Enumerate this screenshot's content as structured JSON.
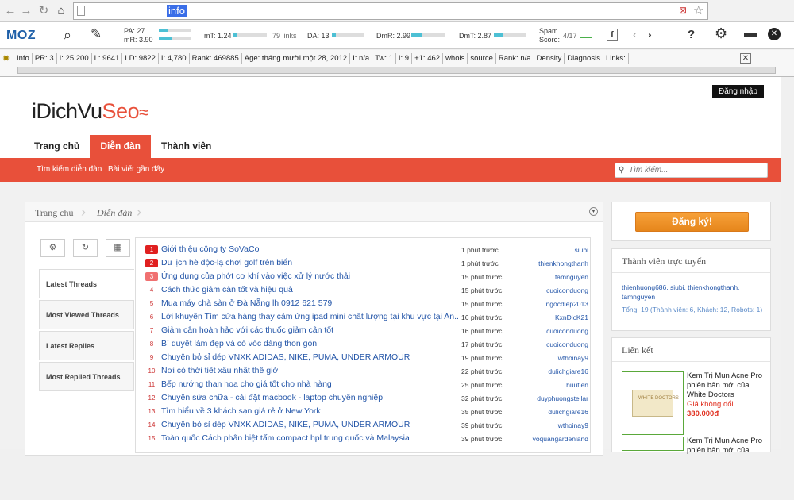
{
  "browser": {
    "url": "info",
    "back_icon": "arrow-left-icon",
    "forward_icon": "arrow-right-icon",
    "reload_icon": "reload-icon",
    "home_icon": "home-icon",
    "page_icon": "page-icon"
  },
  "moz": {
    "logo": "MOZ",
    "pa": "PA: 27",
    "mr": "mR: 3.90",
    "mt": "mT: 1.24",
    "links": "79 links",
    "da": "DA: 13",
    "dmr": "DmR: 2.99",
    "dmt": "DmT: 2.87",
    "spam_label1": "Spam",
    "spam_label2": "Score:",
    "spam_value": "4/17",
    "fb": "f",
    "help": "?"
  },
  "seo": {
    "items": [
      "Info",
      "PR: 3",
      "I: 25,200",
      "L: 9641",
      "LD: 9822",
      "I: 4,780",
      "Rank: 469885",
      "Age: tháng mười một 28, 2012",
      "I: n/a",
      "Tw: 1",
      "I: 9",
      "+1: 462",
      "whois",
      "source",
      "Rank: n/a",
      "Density",
      "Diagnosis",
      "Links:"
    ]
  },
  "site": {
    "login_tip": "Đăng nhập",
    "logo_main": "iDichVu",
    "logo_accent": "Seo",
    "nav": [
      "Trang chủ",
      "Diễn đàn",
      "Thành viên"
    ],
    "subnav": [
      "Tìm kiếm diễn đàn",
      "Bài viết gần đây"
    ],
    "search_placeholder": "Tìm kiếm...",
    "breadcrumb": [
      "Trang chủ",
      "Diễn đàn"
    ],
    "tabs": [
      "Latest Threads",
      "Most Viewed Threads",
      "Latest Replies",
      "Most Replied Threads"
    ],
    "threads": [
      {
        "n": "1",
        "title": "Giới thiệu công ty SoVaCo",
        "time": "1 phút trước",
        "user": "siubi"
      },
      {
        "n": "2",
        "title": "Du lịch hè độc-lạ chơi golf trên biển",
        "time": "1 phút trước",
        "user": "thienkhongthanh"
      },
      {
        "n": "3",
        "title": "Ứng dụng của phớt cơ khí vào việc xử lý nước thải",
        "time": "15 phút trước",
        "user": "tamnguyen"
      },
      {
        "n": "4",
        "title": "Cách thức giảm cân tốt và hiệu quả",
        "time": "15 phút trước",
        "user": "cuoiconduong"
      },
      {
        "n": "5",
        "title": "Mua máy chà sàn ở Đà Nẵng lh 0912 621 579",
        "time": "15 phút trước",
        "user": "ngocdiep2013"
      },
      {
        "n": "6",
        "title": "Lời khuyên Tìm cửa hàng thay cảm ứng ipad mini chất lượng tại khu vực tại An...",
        "time": "16 phút trước",
        "user": "KxnDicK21"
      },
      {
        "n": "7",
        "title": "Giảm cân hoàn hảo với các thuốc giảm cân tốt",
        "time": "16 phút trước",
        "user": "cuoiconduong"
      },
      {
        "n": "8",
        "title": "Bí quyết làm đẹp và có vóc dáng thon gọn",
        "time": "17 phút trước",
        "user": "cuoiconduong"
      },
      {
        "n": "9",
        "title": "Chuyên bỏ sỉ dép VNXK ADIDAS, NIKE, PUMA, UNDER ARMOUR",
        "time": "19 phút trước",
        "user": "wthoinay9"
      },
      {
        "n": "10",
        "title": "Nơi có thời tiết xấu nhất thế giới",
        "time": "22 phút trước",
        "user": "dulichgiare16"
      },
      {
        "n": "11",
        "title": "Bếp nướng than hoa cho giá tốt cho nhà hàng",
        "time": "25 phút trước",
        "user": "huutien"
      },
      {
        "n": "12",
        "title": "Chuyên sửa chữa - cài đặt macbook - laptop chuyên nghiệp",
        "time": "32 phút trước",
        "user": "duyphuongstellar"
      },
      {
        "n": "13",
        "title": "Tìm hiểu về 3 khách sạn giá rẻ ở New York",
        "time": "35 phút trước",
        "user": "dulichgiare16"
      },
      {
        "n": "14",
        "title": "Chuyên bỏ sỉ dép VNXK ADIDAS, NIKE, PUMA, UNDER ARMOUR",
        "time": "39 phút trước",
        "user": "wthoinay9"
      },
      {
        "n": "15",
        "title": "Toàn quốc Cách phân biệt tấm compact hpl trung quốc và Malaysia",
        "time": "39 phút trước",
        "user": "voquangardenland"
      }
    ],
    "signup": "Đăng ký!",
    "online_title": "Thành viên trực tuyến",
    "online_users": "thienhuong686, siubi, thienkhongthanh, tamnguyen",
    "online_stats": "Tổng: 19 (Thành viên: 6, Khách: 12, Robots: 1)",
    "links_title": "Liên kết",
    "ads": [
      {
        "t1": "Kem Trị Mụn Acne Pro phiên bản mới của White Doctors",
        "t2": "Giá không đổi",
        "t3": "380.000đ",
        "box_label": "WHITE DOCTORS"
      },
      {
        "t1": "Kem Trị Mụn Acne Pro phiên bản mới của"
      }
    ]
  },
  "colors": {
    "accent": "#e8503a",
    "link": "#2355a8",
    "signup": "#f39a30"
  }
}
